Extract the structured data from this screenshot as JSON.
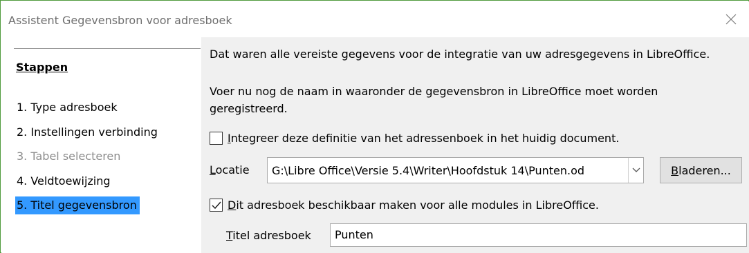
{
  "window": {
    "title": "Assistent Gegevensbron voor adresboek"
  },
  "sidebar": {
    "heading": "Stappen",
    "steps": [
      {
        "label": "1. Type adresboek",
        "state": "normal"
      },
      {
        "label": "2. Instellingen verbinding",
        "state": "normal"
      },
      {
        "label": "3. Tabel selecteren",
        "state": "disabled"
      },
      {
        "label": "4. Veldtoewijzing",
        "state": "normal"
      },
      {
        "label": "5. Titel gegevensbron",
        "state": "active"
      }
    ]
  },
  "main": {
    "intro_text": "Dat waren alle vereiste gegevens voor de integratie van uw adresgegevens in LibreOffice.",
    "instruction_line1": "Voer nu nog de naam in waaronder de gegevensbron in LibreOffice moet worden",
    "instruction_line2": "geregistreerd.",
    "embed_checkbox": {
      "label": "Integreer deze definitie van het adressenboek in het huidig document.",
      "checked": false
    },
    "location": {
      "label": "Locatie",
      "value": "G:\\Libre Office\\Versie 5.4\\Writer\\Hoofdstuk 14\\Punten.od"
    },
    "browse_label": "Bladeren...",
    "available_checkbox": {
      "label": "Dit adresboek beschikbaar maken voor alle modules in LibreOffice.",
      "checked": true
    },
    "title_field": {
      "label": "Titel adresboek",
      "value": "Punten"
    }
  },
  "colors": {
    "window_border": "#4f9a3c",
    "selection": "#3399ff",
    "panel_bg": "#f0f0f0"
  }
}
